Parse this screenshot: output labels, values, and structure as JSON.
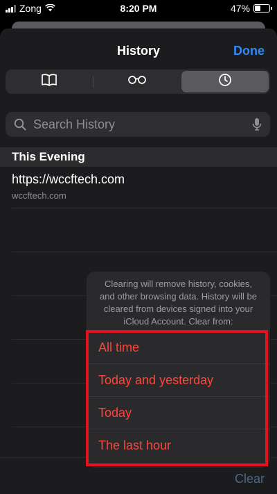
{
  "status_bar": {
    "carrier": "Zong",
    "time": "8:20 PM",
    "battery_percent": "47%",
    "battery_level": 0.47
  },
  "nav": {
    "title": "History",
    "done_label": "Done"
  },
  "segments": [
    {
      "icon": "book-icon",
      "selected": false
    },
    {
      "icon": "reading-glasses-icon",
      "selected": false
    },
    {
      "icon": "clock-icon",
      "selected": true
    }
  ],
  "search": {
    "placeholder": "Search History"
  },
  "section": {
    "title": "This Evening"
  },
  "history": [
    {
      "title": "https://wccftech.com",
      "url": "wccftech.com"
    }
  ],
  "toolbar": {
    "clear_label": "Clear"
  },
  "clear_sheet": {
    "message": "Clearing will remove history, cookies, and other browsing data. History will be cleared from devices signed into your iCloud Account. Clear from:",
    "options": [
      "All time",
      "Today and yesterday",
      "Today",
      "The last hour"
    ]
  },
  "colors": {
    "accent": "#2f8bf5",
    "destructive": "#ff453a",
    "highlight": "#e3121f"
  }
}
